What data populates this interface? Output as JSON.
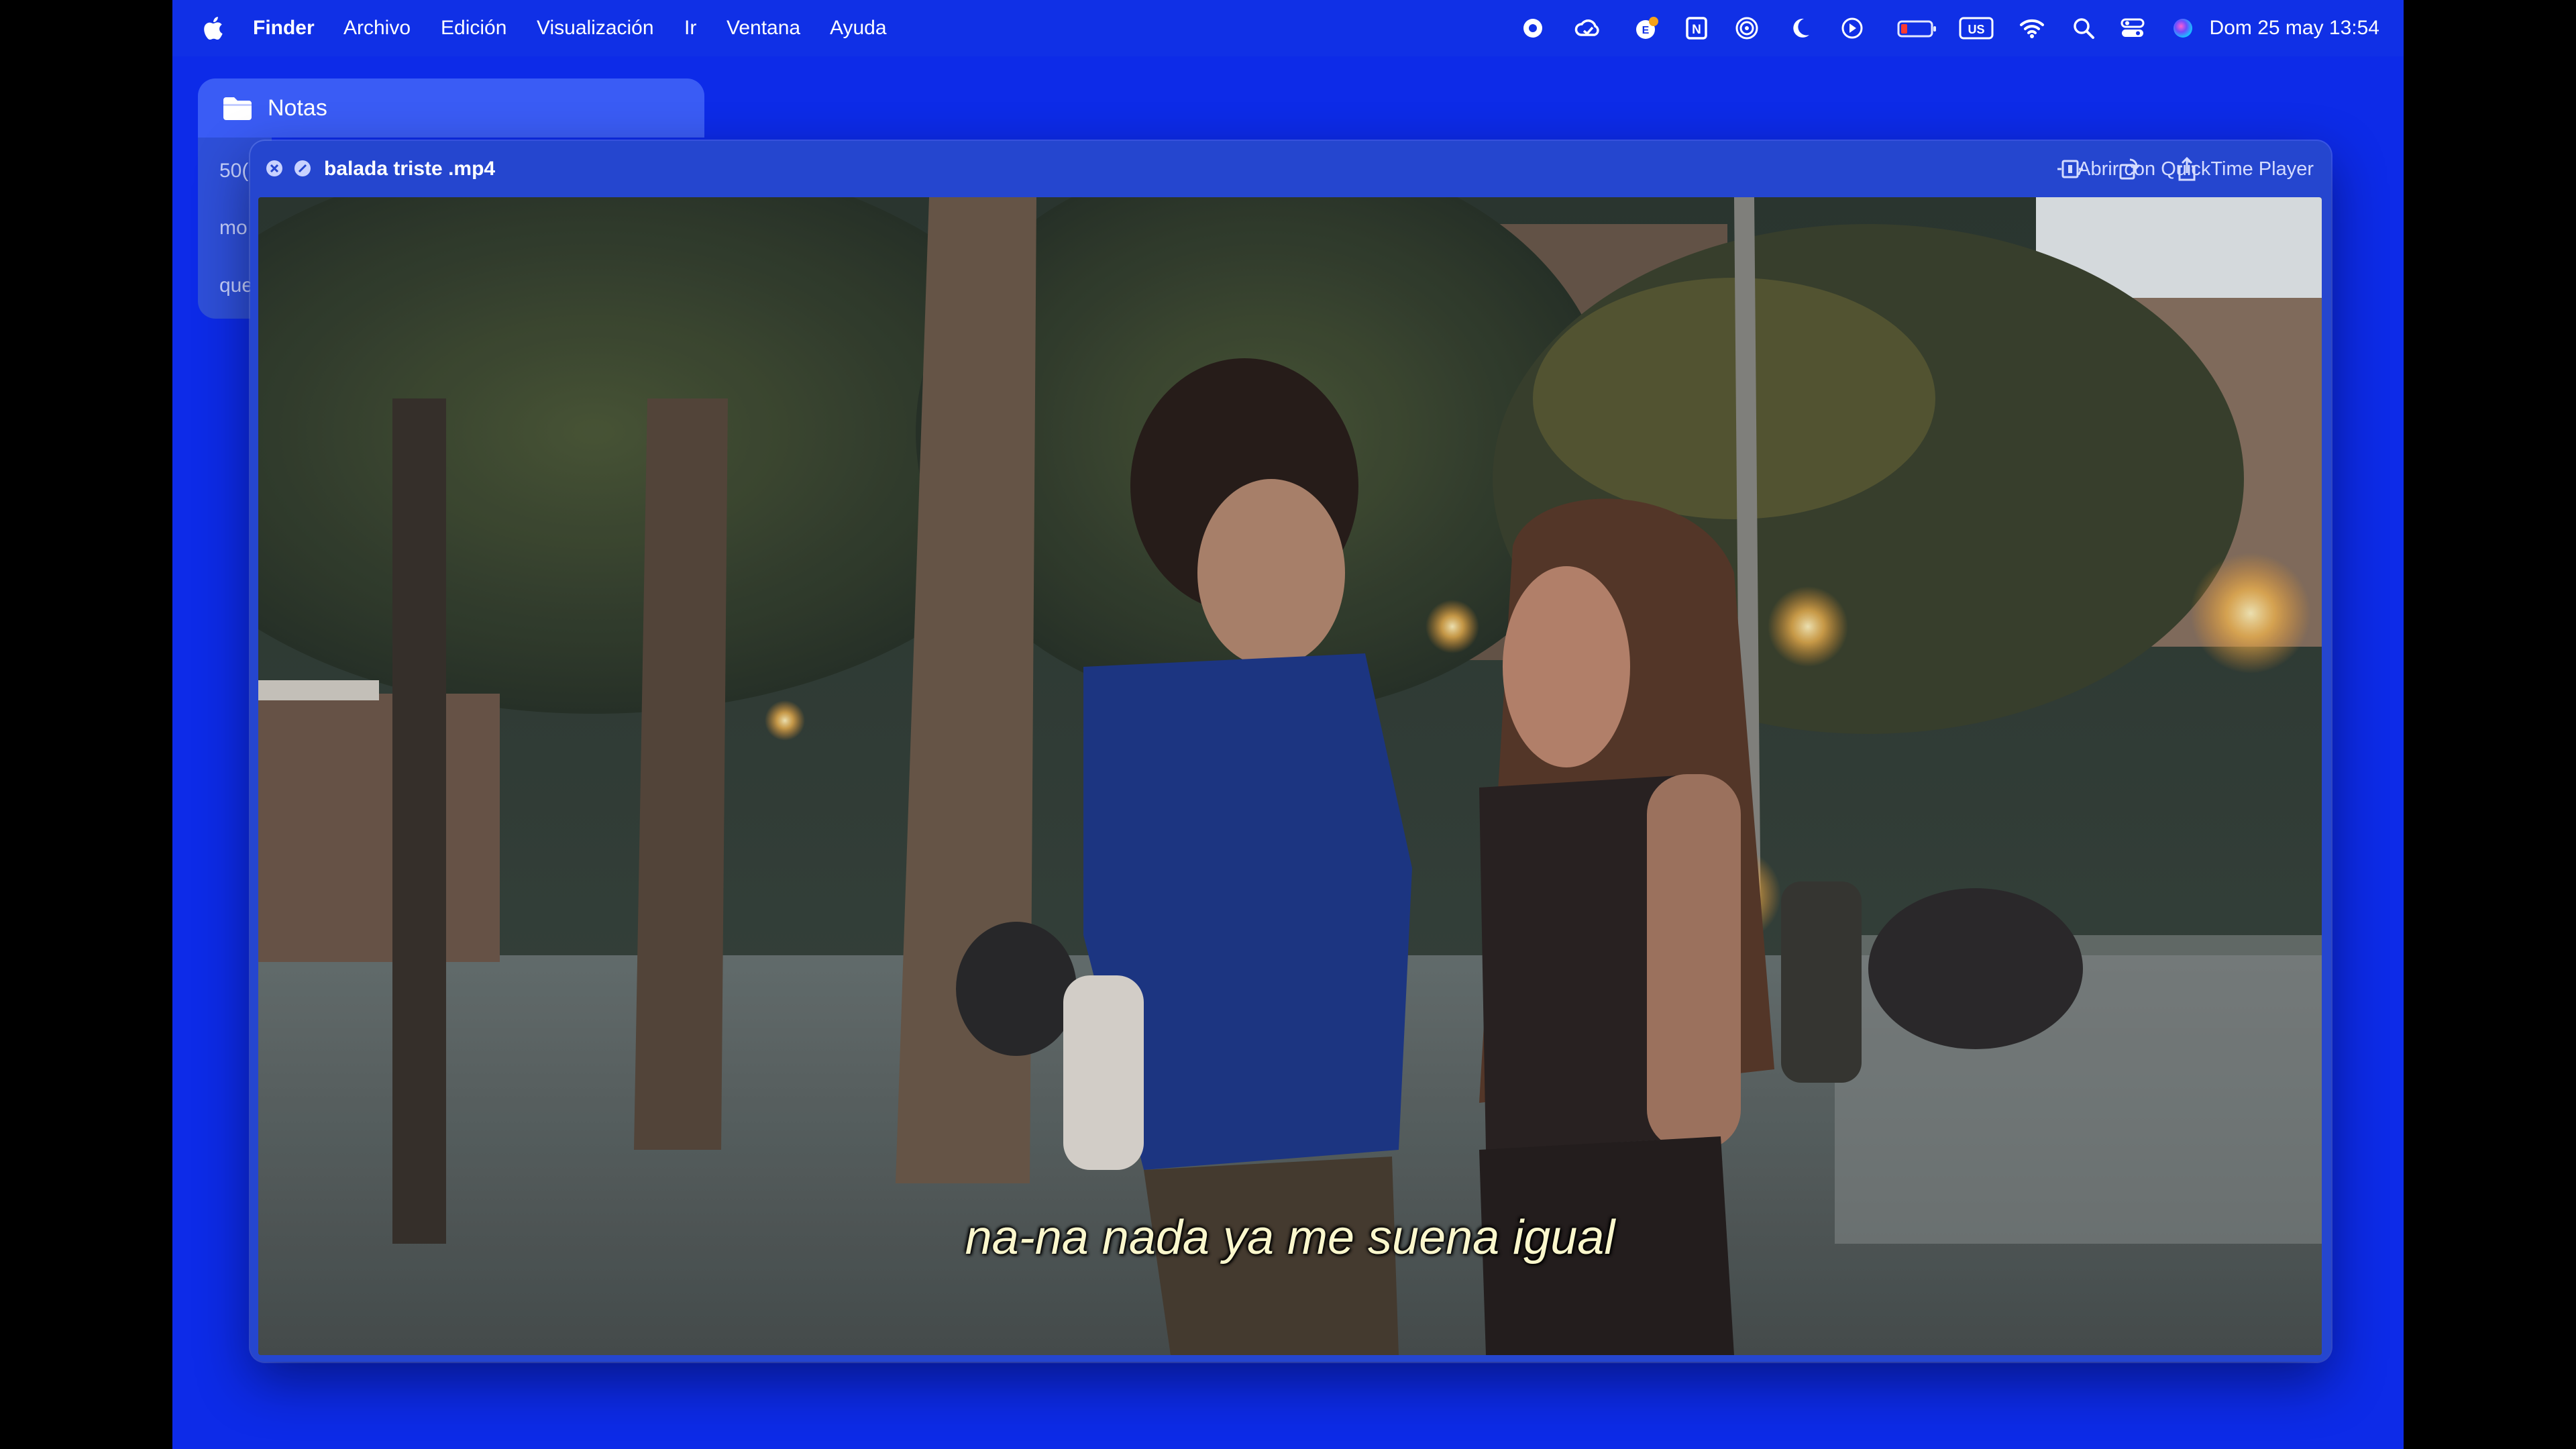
{
  "menubar": {
    "apple_icon": "apple-logo-icon",
    "items": [
      "Finder",
      "Archivo",
      "Edición",
      "Visualización",
      "Ir",
      "Ventana",
      "Ayuda"
    ],
    "status_icons": [
      "record-icon",
      "cloud-icon",
      "badge-app-icon",
      "notion-icon",
      "airdrop-icon",
      "moon-icon",
      "play-icon",
      "battery-icon",
      "keyboard-layout-icon",
      "wifi-icon",
      "search-icon",
      "control-center-icon",
      "siri-icon"
    ],
    "keyboard_layout": "US",
    "clock": "Dom 25 may  13:54"
  },
  "notes": {
    "title": "Notas",
    "rows": [
      "50(",
      "mo",
      "que"
    ]
  },
  "quicklook": {
    "file_name": "balada triste .mp4",
    "open_with": "Abrir con QuickTime Player",
    "toolbar_icons": [
      "trim-icon",
      "rotate-icon",
      "share-icon"
    ],
    "subtitle": "na-na nada ya me suena igual"
  },
  "colors": {
    "desktop": "#0d2be8",
    "menubar": "#1030e6",
    "window": "#2546cf"
  }
}
